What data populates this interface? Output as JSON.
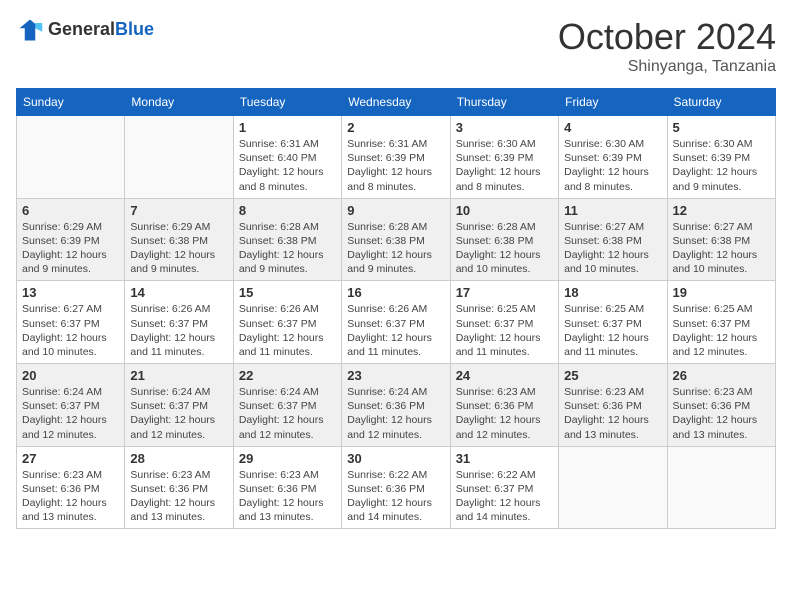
{
  "header": {
    "logo_general": "General",
    "logo_blue": "Blue",
    "month_title": "October 2024",
    "subtitle": "Shinyanga, Tanzania"
  },
  "weekdays": [
    "Sunday",
    "Monday",
    "Tuesday",
    "Wednesday",
    "Thursday",
    "Friday",
    "Saturday"
  ],
  "weeks": [
    [
      {
        "day": "",
        "info": ""
      },
      {
        "day": "",
        "info": ""
      },
      {
        "day": "1",
        "info": "Sunrise: 6:31 AM\nSunset: 6:40 PM\nDaylight: 12 hours and 8 minutes."
      },
      {
        "day": "2",
        "info": "Sunrise: 6:31 AM\nSunset: 6:39 PM\nDaylight: 12 hours and 8 minutes."
      },
      {
        "day": "3",
        "info": "Sunrise: 6:30 AM\nSunset: 6:39 PM\nDaylight: 12 hours and 8 minutes."
      },
      {
        "day": "4",
        "info": "Sunrise: 6:30 AM\nSunset: 6:39 PM\nDaylight: 12 hours and 8 minutes."
      },
      {
        "day": "5",
        "info": "Sunrise: 6:30 AM\nSunset: 6:39 PM\nDaylight: 12 hours and 9 minutes."
      }
    ],
    [
      {
        "day": "6",
        "info": "Sunrise: 6:29 AM\nSunset: 6:39 PM\nDaylight: 12 hours and 9 minutes."
      },
      {
        "day": "7",
        "info": "Sunrise: 6:29 AM\nSunset: 6:38 PM\nDaylight: 12 hours and 9 minutes."
      },
      {
        "day": "8",
        "info": "Sunrise: 6:28 AM\nSunset: 6:38 PM\nDaylight: 12 hours and 9 minutes."
      },
      {
        "day": "9",
        "info": "Sunrise: 6:28 AM\nSunset: 6:38 PM\nDaylight: 12 hours and 9 minutes."
      },
      {
        "day": "10",
        "info": "Sunrise: 6:28 AM\nSunset: 6:38 PM\nDaylight: 12 hours and 10 minutes."
      },
      {
        "day": "11",
        "info": "Sunrise: 6:27 AM\nSunset: 6:38 PM\nDaylight: 12 hours and 10 minutes."
      },
      {
        "day": "12",
        "info": "Sunrise: 6:27 AM\nSunset: 6:38 PM\nDaylight: 12 hours and 10 minutes."
      }
    ],
    [
      {
        "day": "13",
        "info": "Sunrise: 6:27 AM\nSunset: 6:37 PM\nDaylight: 12 hours and 10 minutes."
      },
      {
        "day": "14",
        "info": "Sunrise: 6:26 AM\nSunset: 6:37 PM\nDaylight: 12 hours and 11 minutes."
      },
      {
        "day": "15",
        "info": "Sunrise: 6:26 AM\nSunset: 6:37 PM\nDaylight: 12 hours and 11 minutes."
      },
      {
        "day": "16",
        "info": "Sunrise: 6:26 AM\nSunset: 6:37 PM\nDaylight: 12 hours and 11 minutes."
      },
      {
        "day": "17",
        "info": "Sunrise: 6:25 AM\nSunset: 6:37 PM\nDaylight: 12 hours and 11 minutes."
      },
      {
        "day": "18",
        "info": "Sunrise: 6:25 AM\nSunset: 6:37 PM\nDaylight: 12 hours and 11 minutes."
      },
      {
        "day": "19",
        "info": "Sunrise: 6:25 AM\nSunset: 6:37 PM\nDaylight: 12 hours and 12 minutes."
      }
    ],
    [
      {
        "day": "20",
        "info": "Sunrise: 6:24 AM\nSunset: 6:37 PM\nDaylight: 12 hours and 12 minutes."
      },
      {
        "day": "21",
        "info": "Sunrise: 6:24 AM\nSunset: 6:37 PM\nDaylight: 12 hours and 12 minutes."
      },
      {
        "day": "22",
        "info": "Sunrise: 6:24 AM\nSunset: 6:37 PM\nDaylight: 12 hours and 12 minutes."
      },
      {
        "day": "23",
        "info": "Sunrise: 6:24 AM\nSunset: 6:36 PM\nDaylight: 12 hours and 12 minutes."
      },
      {
        "day": "24",
        "info": "Sunrise: 6:23 AM\nSunset: 6:36 PM\nDaylight: 12 hours and 12 minutes."
      },
      {
        "day": "25",
        "info": "Sunrise: 6:23 AM\nSunset: 6:36 PM\nDaylight: 12 hours and 13 minutes."
      },
      {
        "day": "26",
        "info": "Sunrise: 6:23 AM\nSunset: 6:36 PM\nDaylight: 12 hours and 13 minutes."
      }
    ],
    [
      {
        "day": "27",
        "info": "Sunrise: 6:23 AM\nSunset: 6:36 PM\nDaylight: 12 hours and 13 minutes."
      },
      {
        "day": "28",
        "info": "Sunrise: 6:23 AM\nSunset: 6:36 PM\nDaylight: 12 hours and 13 minutes."
      },
      {
        "day": "29",
        "info": "Sunrise: 6:23 AM\nSunset: 6:36 PM\nDaylight: 12 hours and 13 minutes."
      },
      {
        "day": "30",
        "info": "Sunrise: 6:22 AM\nSunset: 6:36 PM\nDaylight: 12 hours and 14 minutes."
      },
      {
        "day": "31",
        "info": "Sunrise: 6:22 AM\nSunset: 6:37 PM\nDaylight: 12 hours and 14 minutes."
      },
      {
        "day": "",
        "info": ""
      },
      {
        "day": "",
        "info": ""
      }
    ]
  ]
}
